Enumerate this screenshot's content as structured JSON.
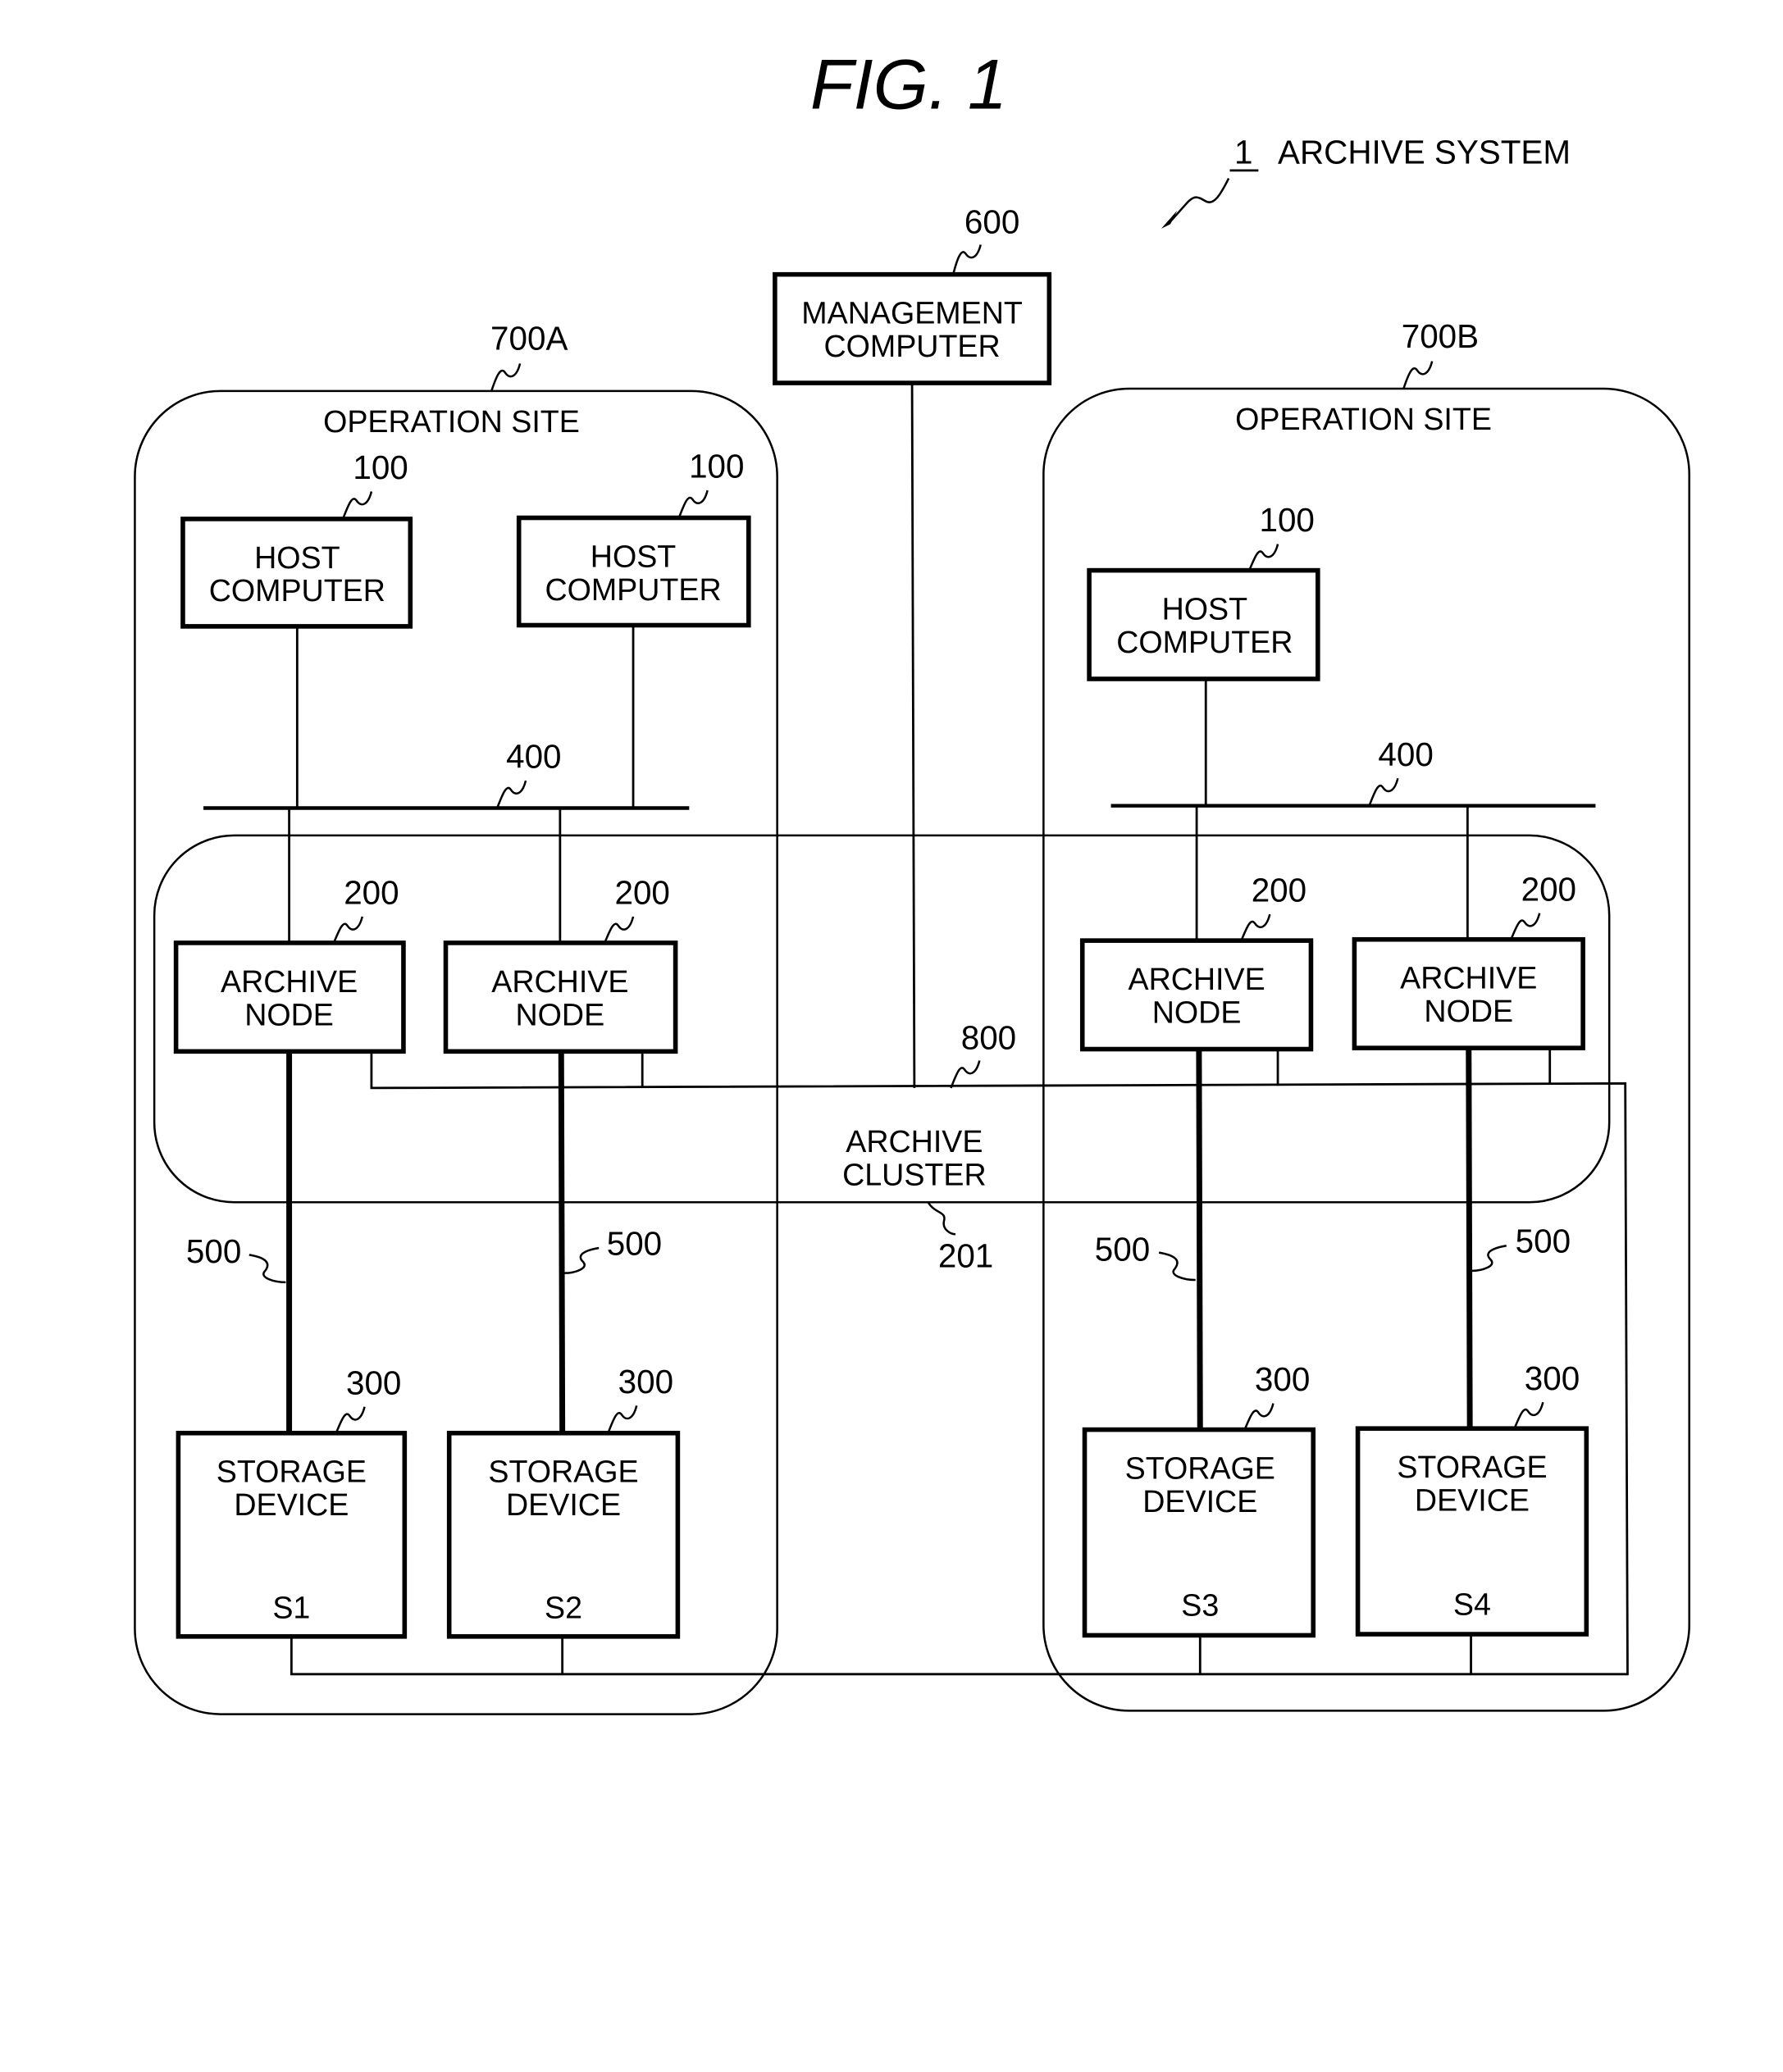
{
  "figure": {
    "title": "FIG.  1",
    "system_ref": "1",
    "system_label": "ARCHIVE SYSTEM"
  },
  "management": {
    "ref": "600",
    "line1": "MANAGEMENT",
    "line2": "COMPUTER"
  },
  "sites": [
    {
      "ref": "700A",
      "label": "OPERATION SITE",
      "hosts": [
        {
          "ref": "100",
          "line1": "HOST",
          "line2": "COMPUTER"
        },
        {
          "ref": "100",
          "line1": "HOST",
          "line2": "COMPUTER"
        }
      ],
      "network_ref": "400",
      "nodes": [
        {
          "ref": "200",
          "line1": "ARCHIVE",
          "line2": "NODE",
          "link_ref": "500"
        },
        {
          "ref": "200",
          "line1": "ARCHIVE",
          "line2": "NODE",
          "link_ref": "500"
        }
      ],
      "storage": [
        {
          "ref": "300",
          "line1": "STORAGE",
          "line2": "DEVICE",
          "id": "S1"
        },
        {
          "ref": "300",
          "line1": "STORAGE",
          "line2": "DEVICE",
          "id": "S2"
        }
      ]
    },
    {
      "ref": "700B",
      "label": "OPERATION SITE",
      "hosts": [
        {
          "ref": "100",
          "line1": "HOST",
          "line2": "COMPUTER"
        }
      ],
      "network_ref": "400",
      "nodes": [
        {
          "ref": "200",
          "line1": "ARCHIVE",
          "line2": "NODE",
          "link_ref": "500"
        },
        {
          "ref": "200",
          "line1": "ARCHIVE",
          "line2": "NODE",
          "link_ref": "500"
        }
      ],
      "storage": [
        {
          "ref": "300",
          "line1": "STORAGE",
          "line2": "DEVICE",
          "id": "S3"
        },
        {
          "ref": "300",
          "line1": "STORAGE",
          "line2": "DEVICE",
          "id": "S4"
        }
      ]
    }
  ],
  "cluster": {
    "ref": "201",
    "line1": "ARCHIVE",
    "line2": "CLUSTER"
  },
  "management_network": {
    "ref": "800"
  }
}
